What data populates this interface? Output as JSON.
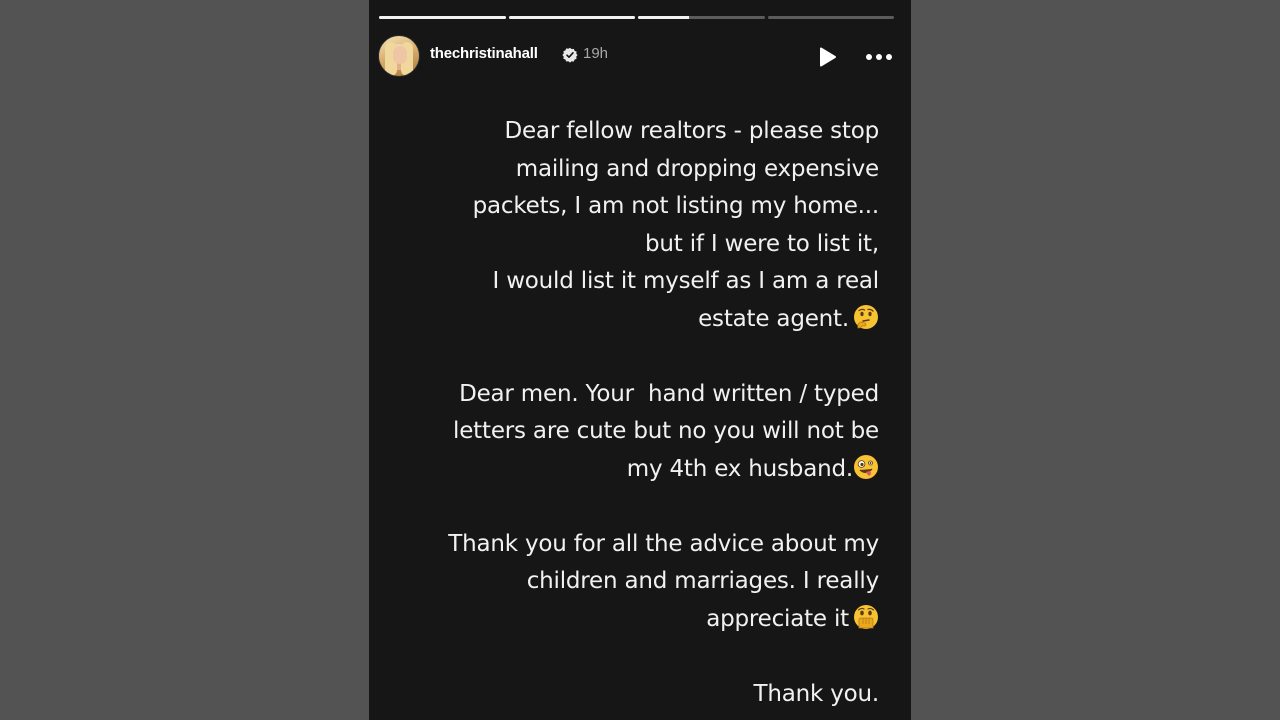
{
  "story": {
    "progress_segments": [
      1,
      1,
      0.4,
      0
    ],
    "user": {
      "username": "thechristinahall",
      "verified": true,
      "time_ago": "19h",
      "avatar_icon": "profile-photo"
    },
    "controls": {
      "play_icon": "play-icon",
      "more_icon": "more-options-icon"
    },
    "paragraphs": [
      {
        "lines": [
          "Dear fellow realtors - please stop",
          "mailing and dropping expensive",
          "packets, I am not listing my home...",
          "but if I were to list it,",
          "I would list it myself as I am a real",
          "estate agent."
        ],
        "emoji": "thinking-face-emoji"
      },
      {
        "lines": [
          "Dear men. Your  hand written / typed",
          "letters are cute but no you will not be",
          "my 4th ex husband."
        ],
        "emoji": "zany-face-emoji"
      },
      {
        "lines": [
          "Thank you for all the advice about my",
          "children and marriages. I really",
          "appreciate it"
        ],
        "emoji": "face-with-hand-over-mouth-emoji"
      },
      {
        "lines": [
          "Thank you."
        ],
        "emoji": ""
      }
    ]
  },
  "colors": {
    "page_background": "#535353",
    "story_background": "#161616",
    "text": "#f1f1f1",
    "muted": "#a8a8a8",
    "emoji_yellow": "#f7c332"
  }
}
